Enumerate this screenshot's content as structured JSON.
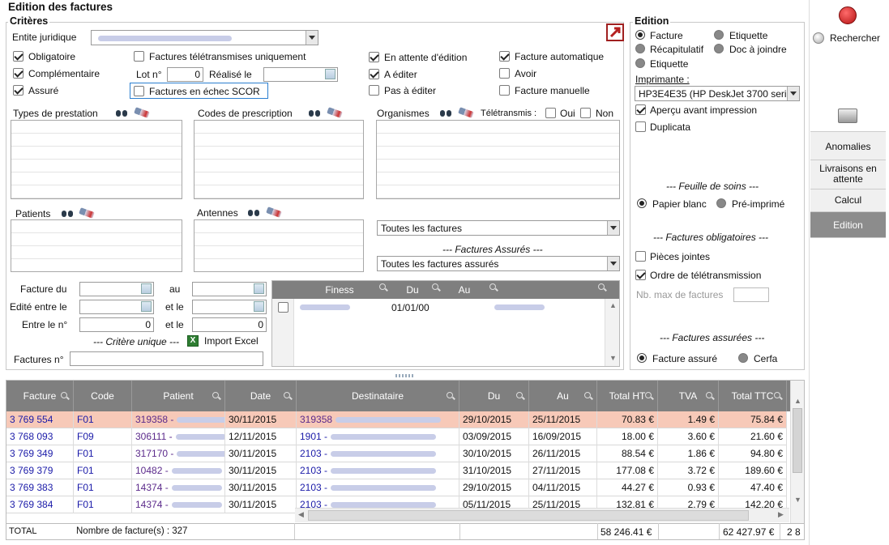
{
  "window_title": "Edition des factures",
  "criteres": {
    "legend": "Critères",
    "entite_label": "Entite juridique",
    "entite_value": "",
    "checks": {
      "obligatoire": {
        "label": "Obligatoire",
        "checked": true
      },
      "complementaire": {
        "label": "Complémentaire",
        "checked": true
      },
      "assure": {
        "label": "Assuré",
        "checked": true
      },
      "teletrans": {
        "label": "Factures télétransmises uniquement",
        "checked": false
      },
      "echec_scor": {
        "label": "Factures en échec SCOR",
        "checked": false
      },
      "attente": {
        "label": "En attente d'édition",
        "checked": true
      },
      "a_editer": {
        "label": "A éditer",
        "checked": true
      },
      "pas_editer": {
        "label": "Pas à éditer",
        "checked": false
      },
      "auto": {
        "label": "Facture automatique",
        "checked": true
      },
      "avoir": {
        "label": "Avoir",
        "checked": false
      },
      "manuelle": {
        "label": "Facture manuelle",
        "checked": false
      }
    },
    "lot_label": "Lot n°",
    "lot_value": "0",
    "realise_label": "Réalisé le",
    "realise_value": "",
    "types_prestation": "Types de prestation",
    "codes_prescription": "Codes de prescription",
    "organismes": "Organismes",
    "teletransmis_label": "Télétransmis :",
    "oui": "Oui",
    "non": "Non",
    "patients": "Patients",
    "antennes": "Antennes",
    "toutes_factures": "Toutes les factures",
    "factures_assures_caption": "--- Factures Assurés ---",
    "toutes_factures_assures": "Toutes les factures assurés",
    "facture_du": "Facture du",
    "au": "au",
    "edite_entre": "Edité entre le",
    "et_le": "et le",
    "entre_le_no": "Entre le n°",
    "entre_from": "0",
    "entre_to": "0",
    "critere_unique": "--- Critère unique ---",
    "import_excel": "Import Excel",
    "factures_no": "Factures n°",
    "finess_grid": {
      "headers": [
        "Finess",
        "Du",
        "Au"
      ],
      "rows": [
        {
          "finess": "",
          "du": "01/01/00",
          "au": ""
        }
      ]
    }
  },
  "edition": {
    "legend": "Edition",
    "radios": [
      {
        "label": "Facture",
        "selected": true
      },
      {
        "label": "Etiquette",
        "selected": false
      },
      {
        "label": "Récapitulatif",
        "selected": false
      },
      {
        "label": "Doc à joindre",
        "selected": false
      },
      {
        "label": "Etiquette",
        "selected": false
      }
    ],
    "imprimante_label": "Imprimante :",
    "imprimante_value": "HP3E4E35 (HP DeskJet 3700 series)",
    "apercu": {
      "label": "Aperçu avant impression",
      "checked": true
    },
    "duplicata": {
      "label": "Duplicata",
      "checked": false
    },
    "feuille_soins": "--- Feuille de soins ---",
    "papier_blanc": "Papier blanc",
    "pre_imprime": "Pré-imprimé",
    "factures_obligatoires": "--- Factures obligatoires ---",
    "pieces_jointes": {
      "label": "Pièces jointes",
      "checked": false
    },
    "ordre_teletrans": {
      "label": "Ordre de télétransmission",
      "checked": true
    },
    "nb_max_label": "Nb. max de factures",
    "factures_assurees": "--- Factures assurées ---",
    "facture_assure": "Facture assuré",
    "cerfa": "Cerfa"
  },
  "sidebar": {
    "rechercher": "Rechercher",
    "items": [
      "Anomalies",
      "Livraisons en attente",
      "Calcul",
      "Edition"
    ],
    "active": "Edition"
  },
  "grid": {
    "columns": [
      "Facture",
      "Code",
      "Patient",
      "Date",
      "Destinataire",
      "Du",
      "Au",
      "Total HT",
      "TVA",
      "Total TTC"
    ],
    "rows": [
      {
        "facture": "3 769 554",
        "code": "F01",
        "patient": "319358 -",
        "date": "30/11/2015",
        "dest": "319358",
        "du": "29/10/2015",
        "au": "25/11/2015",
        "ht": "70.83 €",
        "tva": "1.49 €",
        "ttc": "75.84 €",
        "selected": true
      },
      {
        "facture": "3 768 093",
        "code": "F09",
        "patient": "306111 -",
        "date": "12/11/2015",
        "dest": "1901 -",
        "du": "03/09/2015",
        "au": "16/09/2015",
        "ht": "18.00 €",
        "tva": "3.60 €",
        "ttc": "21.60 €",
        "selected": false
      },
      {
        "facture": "3 769 349",
        "code": "F01",
        "patient": "317170 -",
        "date": "30/11/2015",
        "dest": "2103 -",
        "du": "30/10/2015",
        "au": "26/11/2015",
        "ht": "88.54 €",
        "tva": "1.86 €",
        "ttc": "94.80 €",
        "selected": false
      },
      {
        "facture": "3 769 379",
        "code": "F01",
        "patient": "10482 -",
        "date": "30/11/2015",
        "dest": "2103 -",
        "du": "31/10/2015",
        "au": "27/11/2015",
        "ht": "177.08 €",
        "tva": "3.72 €",
        "ttc": "189.60 €",
        "selected": false
      },
      {
        "facture": "3 769 383",
        "code": "F01",
        "patient": "14374 -",
        "date": "30/11/2015",
        "dest": "2103 -",
        "du": "29/10/2015",
        "au": "04/11/2015",
        "ht": "44.27 €",
        "tva": "0.93 €",
        "ttc": "47.40 €",
        "selected": false
      },
      {
        "facture": "3 769 384",
        "code": "F01",
        "patient": "14374 -",
        "date": "30/11/2015",
        "dest": "2103 -",
        "du": "05/11/2015",
        "au": "25/11/2015",
        "ht": "132.81 €",
        "tva": "2.79 €",
        "ttc": "142.20 €",
        "selected": false
      }
    ],
    "footer": {
      "total_label": "TOTAL",
      "count_text": "Nombre de facture(s) : 327",
      "total_ht": "58 246.41 €",
      "total_ttc": "62 427.97 €",
      "extra": "2 8"
    }
  },
  "colors": {
    "selected_row": "#f7c9b8",
    "grid_header": "#7f7f7f",
    "active_tab": "#8c8c8c",
    "highlight_border": "#2b7fd0"
  }
}
